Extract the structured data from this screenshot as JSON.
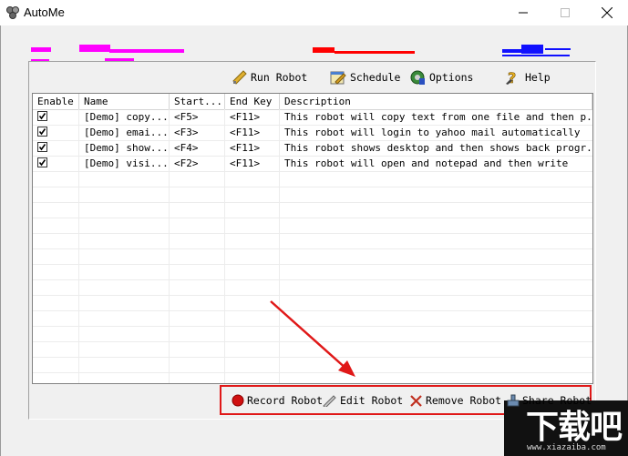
{
  "window": {
    "title": "AutoMe"
  },
  "toolbar": {
    "run_robot": "Run Robot",
    "schedule": "Schedule",
    "options": "Options",
    "help": "Help"
  },
  "table": {
    "columns": [
      "Enable",
      "Name",
      "Start...",
      "End Key",
      "Description"
    ],
    "rows": [
      {
        "enabled": true,
        "name": "[Demo] copy...",
        "start": "<F5>",
        "end": "<F11>",
        "description": "This robot will copy text from one file and then p..."
      },
      {
        "enabled": true,
        "name": "[Demo] emai...",
        "start": "<F3>",
        "end": "<F11>",
        "description": "This robot will login to yahoo mail automatically"
      },
      {
        "enabled": true,
        "name": "[Demo] show...",
        "start": "<F4>",
        "end": "<F11>",
        "description": "This robot shows desktop and then shows back progr..."
      },
      {
        "enabled": true,
        "name": "[Demo] visi...",
        "start": "<F2>",
        "end": "<F11>",
        "description": "This robot will open and notepad and then write"
      }
    ]
  },
  "bottom_bar": {
    "record_robot": "Record Robot",
    "edit_robot": "Edit Robot",
    "remove_robot": "Remove Robot",
    "share_robot": "Share Robot"
  },
  "watermark": {
    "main": "下载吧",
    "sub": "www.xiazaiba.com"
  },
  "colors": {
    "annotation_red": "#e01818",
    "record_red": "#d01010",
    "banner_magenta": "#ff00ff",
    "banner_blue": "#1010ff"
  }
}
